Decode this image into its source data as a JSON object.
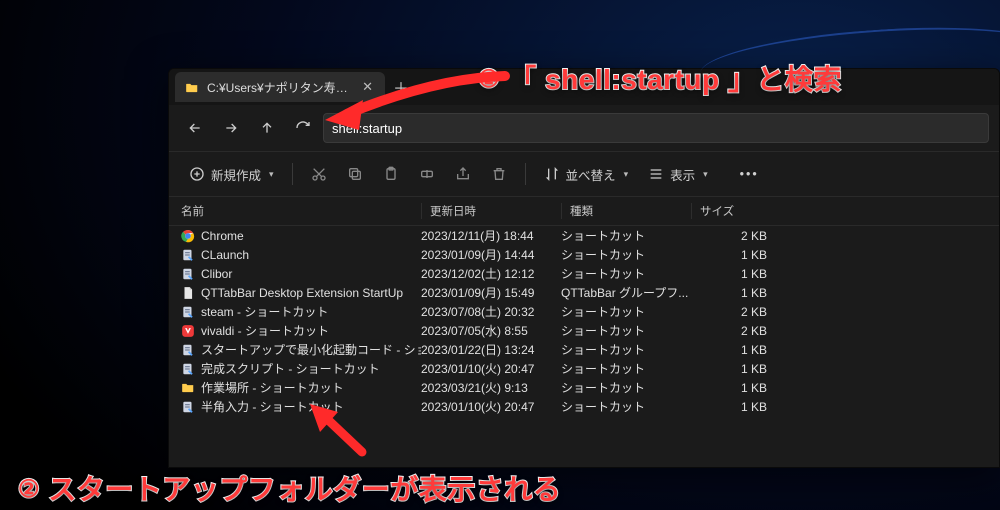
{
  "annotations": {
    "a1_num": "①",
    "a1_text": "「 shell:startup 」と検索",
    "a2_num": "②",
    "a2_text": "スタートアップフォルダーが表示される"
  },
  "explorer": {
    "tab_title": "C:¥Users¥ナポリタン寿司¥AppD:",
    "address_value": "shell:startup",
    "toolbar": {
      "new_label": "新規作成",
      "sort_label": "並べ替え",
      "view_label": "表示"
    },
    "columns": {
      "name": "名前",
      "date": "更新日時",
      "type": "種類",
      "size": "サイズ"
    },
    "files": [
      {
        "icon": "chrome",
        "name": "Chrome",
        "date": "2023/12/11(月) 18:44",
        "type": "ショートカット",
        "size": "2 KB"
      },
      {
        "icon": "generic",
        "name": "CLaunch",
        "date": "2023/01/09(月) 14:44",
        "type": "ショートカット",
        "size": "1 KB"
      },
      {
        "icon": "generic",
        "name": "Clibor",
        "date": "2023/12/02(土) 12:12",
        "type": "ショートカット",
        "size": "1 KB"
      },
      {
        "icon": "doc",
        "name": "QTTabBar Desktop Extension StartUp",
        "date": "2023/01/09(月) 15:49",
        "type": "QTTabBar グループフ...",
        "size": "1 KB"
      },
      {
        "icon": "generic",
        "name": "steam - ショートカット",
        "date": "2023/07/08(土) 20:32",
        "type": "ショートカット",
        "size": "2 KB"
      },
      {
        "icon": "vivaldi",
        "name": "vivaldi - ショートカット",
        "date": "2023/07/05(水) 8:55",
        "type": "ショートカット",
        "size": "2 KB"
      },
      {
        "icon": "generic",
        "name": "スタートアップで最小化起動コード - ショートカット",
        "date": "2023/01/22(日) 13:24",
        "type": "ショートカット",
        "size": "1 KB"
      },
      {
        "icon": "generic",
        "name": "完成スクリプト - ショートカット",
        "date": "2023/01/10(火) 20:47",
        "type": "ショートカット",
        "size": "1 KB"
      },
      {
        "icon": "folder",
        "name": "作業場所 - ショートカット",
        "date": "2023/03/21(火) 9:13",
        "type": "ショートカット",
        "size": "1 KB"
      },
      {
        "icon": "generic",
        "name": "半角入力 - ショートカット",
        "date": "2023/01/10(火) 20:47",
        "type": "ショートカット",
        "size": "1 KB"
      }
    ]
  }
}
